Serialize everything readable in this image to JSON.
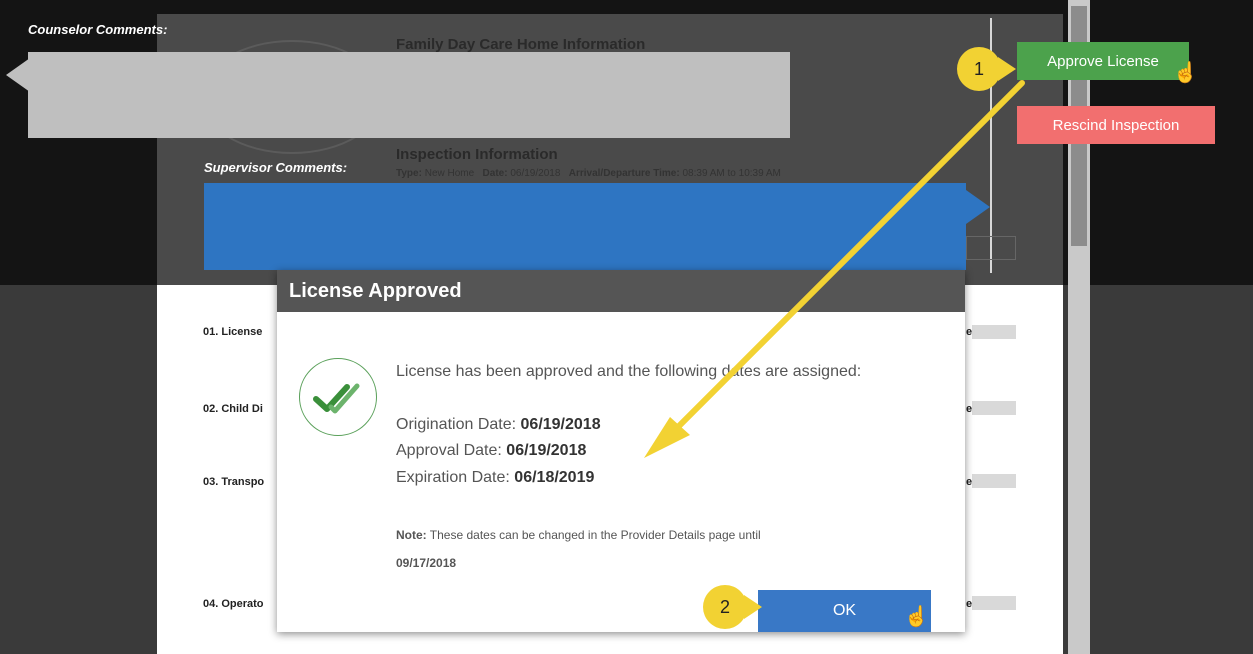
{
  "colors": {
    "approve": "#4ca24c",
    "rescind": "#f26f6f",
    "ok": "#3978c6",
    "supervisor_box": "#2e75c2",
    "callout": "#f2d233",
    "arrow": "#f2d233"
  },
  "background": {
    "counselor_label": "Counselor Comments:",
    "supervisor_label": "Supervisor Comments:",
    "doc_title": "Family Day Care Home Information",
    "inspection_title": "Inspection Information",
    "inspection_meta": {
      "type_label": "Type:",
      "type_value": "New Home",
      "date_label": "Date:",
      "date_value": "06/19/2018",
      "time_label": "Arrival/Departure Time:",
      "time_value": "08:39 AM to 10:39 AM"
    },
    "rows": [
      "01. License",
      "02. Child Di",
      "03. Transpo",
      "04. Operato"
    ],
    "row_suffix": "e"
  },
  "buttons": {
    "approve": "Approve License",
    "rescind": "Rescind Inspection"
  },
  "modal": {
    "title": "License Approved",
    "intro": "License has been approved and the following dates are assigned:",
    "origination_label": "Origination Date:",
    "origination_value": "06/19/2018",
    "approval_label": "Approval Date:",
    "approval_value": "06/19/2018",
    "expiration_label": "Expiration Date:",
    "expiration_value": "06/18/2019",
    "note_label": "Note:",
    "note_text": "These dates can be changed in the Provider Details page until",
    "note_date": "09/17/2018",
    "ok": "OK",
    "icon": "double-check-icon"
  },
  "callouts": {
    "step1": "1",
    "step2": "2"
  },
  "icons": {
    "cursor": "hand-pointer-icon",
    "check": "double-check-icon"
  }
}
